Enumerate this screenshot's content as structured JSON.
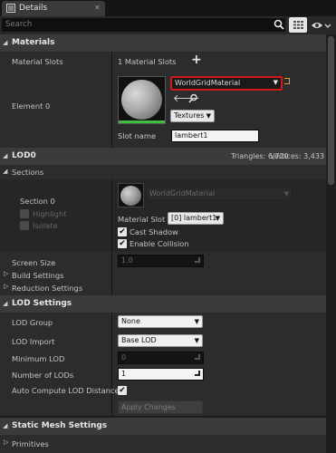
{
  "tab": {
    "title": "Details",
    "close_glyph": "✕"
  },
  "search": {
    "placeholder": "Search"
  },
  "materials": {
    "header": "Materials",
    "slots_label": "Material Slots",
    "slots_value": "1 Material Slots",
    "add_glyph": "+",
    "element_label": "Element 0",
    "material_name": "WorldGridMaterial",
    "textures_label": "Textures",
    "slot_name_label": "Slot name",
    "slot_name_value": "lambert1"
  },
  "lod0": {
    "header": "LOD0",
    "triangles": "Triangles: 6,720",
    "vertices": "Vertices: 3,433",
    "sections_label": "Sections",
    "section_label": "Section 0",
    "highlight_label": "Highlight",
    "isolate_label": "Isolate",
    "material_name": "WorldGridMaterial",
    "material_slot_label": "Material Slot",
    "material_slot_value": "[0] lambert1",
    "cast_shadow_label": "Cast Shadow",
    "enable_collision_label": "Enable Collision",
    "screen_size_label": "Screen Size",
    "screen_size_value": "1.0",
    "build_settings_label": "Build Settings",
    "reduction_settings_label": "Reduction Settings"
  },
  "lod_settings": {
    "header": "LOD Settings",
    "lod_group_label": "LOD Group",
    "lod_group_value": "None",
    "lod_import_label": "LOD Import",
    "lod_import_value": "Base LOD",
    "minimum_lod_label": "Minimum LOD",
    "minimum_lod_value": "0",
    "number_of_lods_label": "Number of LODs",
    "number_of_lods_value": "1",
    "auto_compute_label": "Auto Compute LOD Distance",
    "apply_changes_label": "Apply Changes"
  },
  "static_mesh": {
    "header": "Static Mesh Settings",
    "primitives_label": "Primitives"
  },
  "colors": {
    "highlight_red": "#d01a1a",
    "green_bar": "#3fbf3f"
  }
}
